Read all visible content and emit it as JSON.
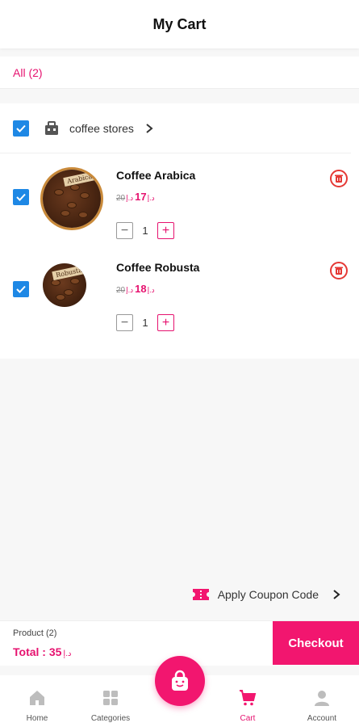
{
  "header": {
    "title": "My Cart"
  },
  "tabs": {
    "all_label": "All (2)"
  },
  "store": {
    "name": "coffee stores"
  },
  "items": [
    {
      "name": "Coffee Arabica",
      "old_price": "20",
      "price": "17",
      "currency": "د.إ",
      "qty": "1",
      "tag": "Arabica"
    },
    {
      "name": "Coffee Robusta",
      "old_price": "20",
      "price": "18",
      "currency": "د.إ",
      "qty": "1",
      "tag": "Robusta"
    }
  ],
  "coupon": {
    "label": "Apply Coupon Code"
  },
  "summary": {
    "product_count": "Product (2)",
    "total_label": "Total : 35",
    "currency": "د.إ",
    "checkout_label": "Checkout"
  },
  "nav": {
    "home": "Home",
    "categories": "Categories",
    "cart": "Cart",
    "account": "Account"
  },
  "colors": {
    "accent": "#f2166f",
    "checkbox": "#1e88e5",
    "delete": "#e53935"
  }
}
